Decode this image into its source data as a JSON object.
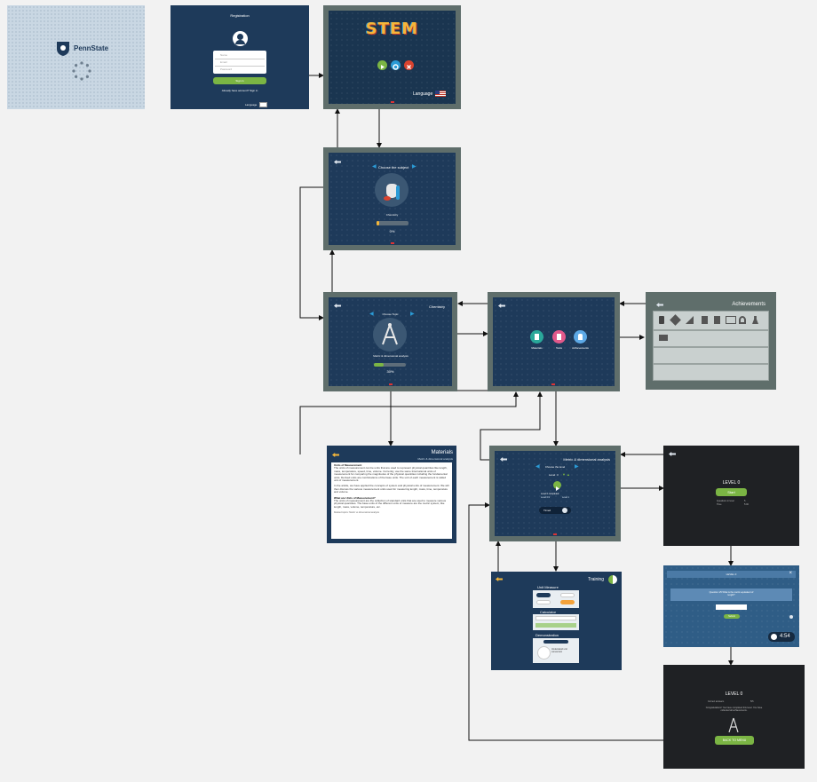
{
  "loading": {
    "brand": "PennState"
  },
  "registration": {
    "title": "Registration",
    "fields": [
      "Name",
      "Email",
      "Password"
    ],
    "sign_in": "Sign in",
    "already": "Already have account? Sign in",
    "lang": "Language"
  },
  "menu": {
    "logo": "STEM",
    "language": "Language"
  },
  "subject": {
    "title": "Choose the subject",
    "subject": "Chemistry",
    "percent": "0%"
  },
  "topic": {
    "title": "Choose Topic",
    "header": "Chemistry",
    "topic": "Metric & dimensional analysis",
    "percent": "30%"
  },
  "hub": {
    "items": [
      "Materials",
      "Tests",
      "Achievements"
    ]
  },
  "achievements": {
    "title": "Achievements"
  },
  "materials": {
    "title": "Materials",
    "subtitle": "Metric & dimensional analysis",
    "para1_head": "Units of Measurement",
    "para1": "The units of measurement can be units that are used to represent physical quantities like length, mass, temperature, speed, time, volume. Currently, use the same International units of measurement for comparing the magnitudes of the physical quantities including the fundamental units. Derived units are combinations of the base units. The unit of each measurement is called unit of measurement.",
    "para2": "In the article, we have applied the concepts of system and physical units of measurement. We will then discuss the various measurement units used for measuring length, mass, time, temperature and volume.",
    "para3_head": "What are Units of Measurement?",
    "para3": "The units of measurement are the collection of standard units that are used to measure various physical quantities. The base units of the different units of measure are the metric system; like length, mass, volume, temperature, etc.",
    "footer": "Related topics: Metric vs dimensional analysis"
  },
  "level_select": {
    "header": "Metric & dimensional analysis",
    "title": "Choose the level",
    "level": "Level",
    "level_num": "3",
    "level_status": "Level 0 completed",
    "row1": "Level 0/1",
    "row2": "Level 1",
    "timed": "Timed"
  },
  "training": {
    "title": "Training",
    "unit_measure": "Unit Measure",
    "calculator": "Calculator",
    "demonstration": "Demonstration",
    "demo_text": "Understand unit conversion"
  },
  "level_start": {
    "level": "LEVEL 0",
    "start": "Start",
    "lines": [
      "Questions in level",
      "Time"
    ],
    "values": [
      "5",
      "5:00"
    ]
  },
  "quiz": {
    "title": "LEVEL 0",
    "question": "Question 1/5 What is the metric equivalent of length?",
    "submit": "Submit",
    "timer": "4:54"
  },
  "results": {
    "level": "LEVEL 0",
    "row1": "Correct answers",
    "row1_value": "5/5",
    "row2": "Congratulations! You have completed this level. You have collected all achievements.",
    "back": "BACK TO MENU"
  }
}
